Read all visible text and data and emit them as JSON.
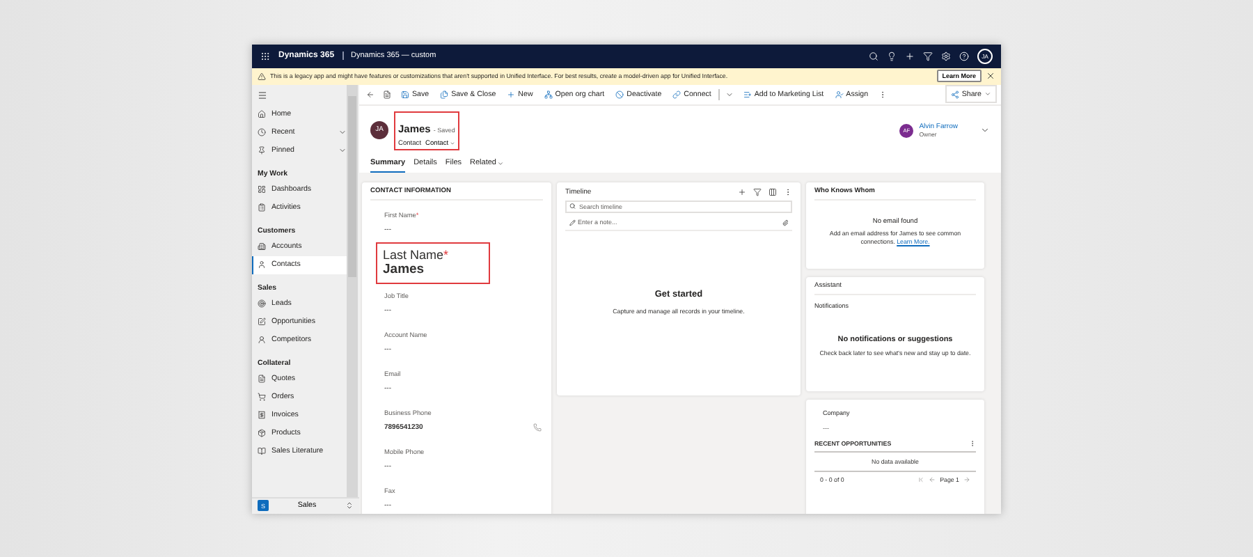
{
  "topbar": {
    "app_name": "Dynamics 365",
    "environment": "Dynamics 365 — custom",
    "avatar": "JA"
  },
  "banner": {
    "message": "This is a legacy app and might have features or customizations that aren't supported in Unified Interface. For best results, create a model-driven app for Unified Interface.",
    "button": "Learn More"
  },
  "sidebar": {
    "sections": [
      {
        "items": [
          {
            "label": "Home",
            "kind": "home",
            "selected": false
          },
          {
            "label": "Recent",
            "kind": "recent",
            "selected": false,
            "expanded": false
          },
          {
            "label": "Pinned",
            "kind": "pinned",
            "selected": false,
            "expanded": false
          }
        ]
      },
      {
        "heading": "My Work",
        "items": [
          {
            "label": "Dashboards",
            "kind": "dashboard",
            "selected": false
          },
          {
            "label": "Activities",
            "kind": "activity",
            "selected": false
          }
        ]
      },
      {
        "heading": "Customers",
        "items": [
          {
            "label": "Accounts",
            "kind": "account",
            "selected": false
          },
          {
            "label": "Contacts",
            "kind": "contact",
            "selected": true
          }
        ]
      },
      {
        "heading": "Sales",
        "items": [
          {
            "label": "Leads",
            "kind": "lead",
            "selected": false
          },
          {
            "label": "Opportunities",
            "kind": "opportunity",
            "selected": false
          },
          {
            "label": "Competitors",
            "kind": "competitor",
            "selected": false
          }
        ]
      },
      {
        "heading": "Collateral",
        "items": [
          {
            "label": "Quotes",
            "kind": "quote",
            "selected": false
          },
          {
            "label": "Orders",
            "kind": "order",
            "selected": false
          },
          {
            "label": "Invoices",
            "kind": "invoice",
            "selected": false
          },
          {
            "label": "Products",
            "kind": "product",
            "selected": false
          },
          {
            "label": "Sales Literature",
            "kind": "literature",
            "selected": false
          }
        ]
      }
    ],
    "area": {
      "badge": "S",
      "label": "Sales"
    }
  },
  "commands": [
    {
      "kind": "save",
      "label": "Save"
    },
    {
      "kind": "save-close",
      "label": "Save & Close"
    },
    {
      "kind": "new",
      "label": "New"
    },
    {
      "kind": "org-chart",
      "label": "Open org chart"
    },
    {
      "kind": "deactivate",
      "label": "Deactivate"
    },
    {
      "kind": "connect",
      "label": "Connect"
    },
    {
      "kind": "add-list",
      "label": "Add to Marketing List"
    },
    {
      "kind": "assign",
      "label": "Assign"
    }
  ],
  "share": "Share",
  "record": {
    "initials": "JA",
    "name": "James",
    "status": "- Saved",
    "entity": "Contact",
    "form": "Contact",
    "highlighted": true,
    "owner": {
      "initials": "AF",
      "name": "Alvin Farrow",
      "role": "Owner"
    }
  },
  "tabs": [
    {
      "label": "Summary",
      "selected": true
    },
    {
      "label": "Details",
      "selected": false
    },
    {
      "label": "Files",
      "selected": false
    },
    {
      "label": "Related",
      "selected": false
    }
  ],
  "contact_card": {
    "heading": "CONTACT INFORMATION",
    "fields": [
      {
        "label": "First Name",
        "required_mark": "*",
        "value": "---",
        "highlighted": false
      },
      {
        "label": "Last Name",
        "required_mark": "*",
        "value": "James",
        "highlighted": true
      },
      {
        "label": "Job Title",
        "value": "---",
        "highlighted": false
      },
      {
        "label": "Account Name",
        "value": "---",
        "highlighted": false
      },
      {
        "label": "Email",
        "value": "---",
        "highlighted": false
      },
      {
        "label": "Business Phone",
        "value": "7896541230",
        "highlighted": false,
        "kind": "phone"
      },
      {
        "label": "Mobile Phone",
        "value": "---",
        "highlighted": false
      },
      {
        "label": "Fax",
        "value": "---",
        "highlighted": false
      }
    ]
  },
  "timeline": {
    "title": "Timeline",
    "search": {
      "placeholder": "Search timeline"
    },
    "note": {
      "placeholder": "Enter a note..."
    },
    "empty_title": "Get started",
    "empty_text": "Capture and manage all records in your timeline."
  },
  "who_knows_whom": {
    "title": "Who Knows Whom",
    "empty_title": "No email found",
    "message": "Add an email address for James to see common connections.",
    "link": "Learn More."
  },
  "assistant": {
    "title": "Assistant",
    "subtitle": "Notifications",
    "empty_title": "No notifications or suggestions",
    "empty_text": "Check back later to see what's new and stay up to date."
  },
  "company": {
    "label": "Company",
    "value": "---",
    "opportunities": {
      "title": "RECENT OPPORTUNITIES",
      "empty_text": "No data available",
      "count": "0 - 0 of 0",
      "page": "Page 1"
    }
  }
}
